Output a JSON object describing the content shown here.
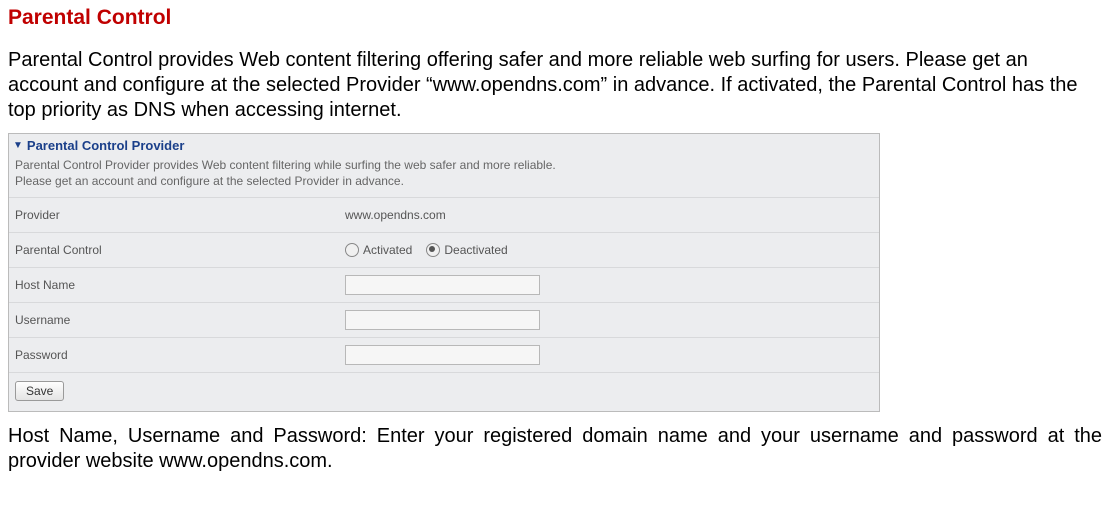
{
  "doc": {
    "title": "Parental Control",
    "intro": "Parental Control provides Web content filtering offering safer and more reliable web surfing for users. Please get an account and configure at the selected Provider “www.opendns.com” in advance. If activated, the Parental Control has the top priority as DNS when accessing internet.",
    "footer": "Host Name, Username and Password: Enter your registered domain name and your username and password at the provider website www.opendns.com."
  },
  "panel": {
    "header": "Parental Control Provider",
    "desc_line1": "Parental Control Provider provides Web content filtering while surfing the web safer and more reliable.",
    "desc_line2": "Please get an account and configure at the selected Provider in advance.",
    "rows": {
      "provider_label": "Provider",
      "provider_value": "www.opendns.com",
      "control_label": "Parental Control",
      "activated": "Activated",
      "deactivated": "Deactivated",
      "hostname_label": "Host Name",
      "username_label": "Username",
      "password_label": "Password"
    },
    "save": "Save"
  }
}
